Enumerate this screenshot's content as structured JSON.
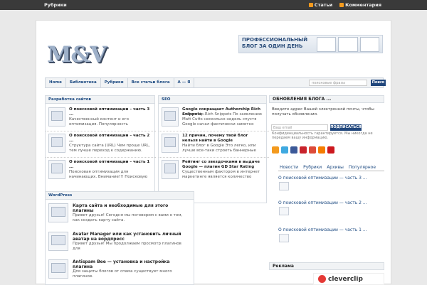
{
  "topbar": {
    "rubrics": "Рубрики",
    "articles": "Статьи",
    "comments": "Комментария"
  },
  "logo": "M&V",
  "banner": {
    "line1": "ПРОФЕССИОНАЛЬНЫЙ",
    "line2": "БЛОГ ЗА ОДИН ДЕНЬ"
  },
  "nav": {
    "items": [
      "Home",
      "Библиотека",
      "Рубрики",
      "Все статьи блога",
      "А — Я"
    ],
    "search_placeholder": "поисковые фразы",
    "search_button": "Поиск"
  },
  "sections": {
    "dev": {
      "title": "Разработка сайтов",
      "items": [
        {
          "title": "О поисковой оптимизации – часть 3 ...",
          "excerpt": "Качественный контент и его оптимизация. Популярность"
        },
        {
          "title": "О поисковой оптимизации – часть 2 ...",
          "excerpt": "Структура сайта (URL) Чем проще URL, тем лучше переход к содержанию."
        },
        {
          "title": "О поисковой оптимизации – часть 1 ...",
          "excerpt": "Поисковая оптимизация для начинающих. Внимание!!! Поисковую"
        }
      ]
    },
    "seo": {
      "title": "SEO",
      "items": [
        {
          "title": "Google сокращает Authorship Rich Snippets",
          "excerpt": "Authorship-Rich Snippets По заявлению Matt Cutts несколько недель спустя Google начал фактически заметно"
        },
        {
          "title": "12 причин, почему твой блог нельзя найти в Google",
          "excerpt": "Найти блог в Google Это легко, или лучше все-таки строеть баннерные"
        },
        {
          "title": "Рейтинг со звездочками в выдаче Google — плагин GD Star Rating",
          "excerpt": "Существенным фактором в интернет маркетинге является количество"
        }
      ]
    },
    "wordpress": {
      "title": "WordPress",
      "items": [
        {
          "title": "Карта сайта и необходимые для этого плагины",
          "excerpt": "Привет друзья! Сегодня мы поговорим с вами о том, как создать карту сайта."
        },
        {
          "title": "Avatar Manager или как установить личный аватар на вордпресс",
          "excerpt": "Привет друзья! Мы продолжаем просмотр плагинов для"
        },
        {
          "title": "Antispam Bee — установка и настройка плагина",
          "excerpt": "Для защиты блогов от спама существует много плагинов."
        }
      ]
    }
  },
  "sidebar": {
    "updates_title": "ОБНОВЛЕНИЯ БЛОГА ...",
    "updates_text": "Введите адрес Вашей электронной почты, чтобы получать обновления.",
    "email_placeholder": "Ваш email",
    "subscribe_button": "ПОДПИСАТЬСЯ",
    "privacy": "Конфиденциальность гарантируется. Мы никогда не передаем вашу информацию.",
    "tabs": [
      "Новости",
      "Рубрики",
      "Архивы",
      "Популярное"
    ],
    "posts": [
      "О поисковой оптимизации — часть 3 ...",
      "О поисковой оптимизации — часть 2 ...",
      "О поисковой оптимизации — часть 1 ..."
    ],
    "ads_title": "Реклама",
    "ad_text": "cleverclip"
  },
  "colors": {
    "nav_text": "#1e4b82",
    "button": "#20467c",
    "topbar": "#3a3a3a",
    "rss": "#f39a1e"
  },
  "icons": [
    "rss-icon",
    "social-icon-rss",
    "social-icon-twitter",
    "social-icon-facebook",
    "social-icon-pinterest",
    "social-icon-google",
    "social-icon-blogger",
    "social-icon-youtube"
  ]
}
